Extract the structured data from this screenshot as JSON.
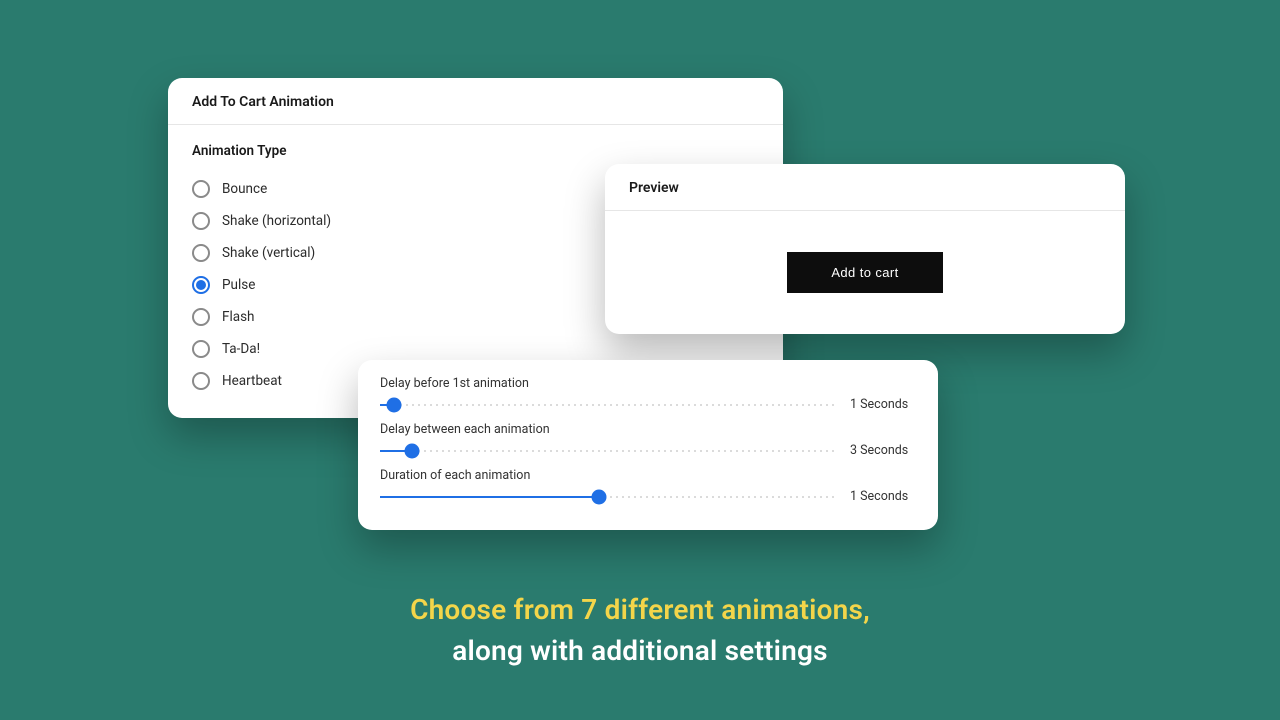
{
  "animation_card": {
    "title": "Add To Cart Animation",
    "section_label": "Animation Type",
    "selected_index": 3,
    "options": [
      "Bounce",
      "Shake (horizontal)",
      "Shake (vertical)",
      "Pulse",
      "Flash",
      "Ta-Da!",
      "Heartbeat"
    ]
  },
  "preview_card": {
    "title": "Preview",
    "button_label": "Add to cart"
  },
  "sliders": [
    {
      "label": "Delay before 1st animation",
      "value_text": "1 Seconds",
      "fill_pct": 3
    },
    {
      "label": "Delay between each animation",
      "value_text": "3 Seconds",
      "fill_pct": 7
    },
    {
      "label": "Duration of each animation",
      "value_text": "1 Seconds",
      "fill_pct": 48
    }
  ],
  "caption": {
    "line1": "Choose from 7 different animations,",
    "line2": "along with additional settings"
  }
}
